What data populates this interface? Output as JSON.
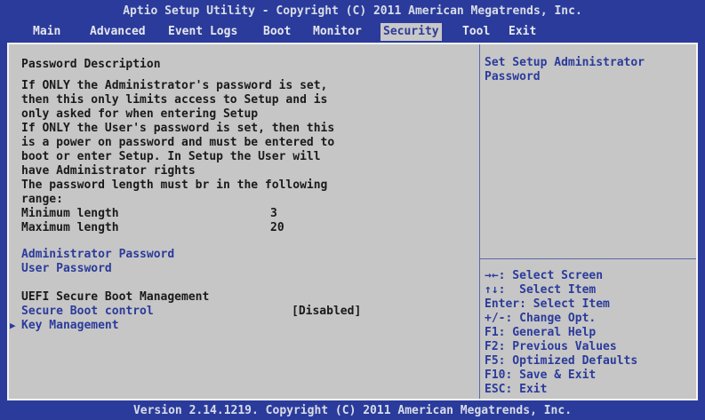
{
  "header": {
    "title": "Aptio Setup Utility - Copyright (C) 2011 American Megatrends, Inc."
  },
  "menu": {
    "tabs": [
      "Main",
      "Advanced",
      "Event Logs",
      "Boot",
      "Monitor",
      "Security",
      "Tool",
      "Exit"
    ],
    "active": "Security"
  },
  "main": {
    "section_title": "Password Description",
    "description_lines": [
      "If ONLY the Administrator's password is set,",
      "then this only limits access to Setup and is",
      "only asked for when entering Setup",
      "If ONLY the User's password is set, then this",
      "is a power on password and must be entered to",
      "boot or enter Setup. In Setup the User will",
      "have Administrator rights",
      "The password length must br in the following",
      "range:"
    ],
    "min_label": "Minimum length",
    "min_value": "3",
    "max_label": "Maximum length",
    "max_value": "20",
    "admin_password": "Administrator Password",
    "user_password": "User Password",
    "uefi_title": "UEFI Secure Boot Management",
    "secure_boot_label": "Secure Boot control",
    "secure_boot_value": "[Disabled]",
    "key_mgmt_arrow": "▶",
    "key_mgmt_label": "Key Management"
  },
  "help": {
    "lines": [
      "Set Setup Administrator",
      "Password"
    ]
  },
  "keys": {
    "lines": [
      "→←: Select Screen",
      "↑↓:  Select Item",
      "Enter: Select Item",
      "+/-: Change Opt.",
      "F1: General Help",
      "F2: Previous Values",
      "F5: Optimized Defaults",
      "F10: Save & Exit",
      "ESC: Exit"
    ]
  },
  "footer": {
    "text": "Version 2.14.1219. Copyright (C) 2011 American Megatrends, Inc."
  },
  "colors": {
    "background": "#2b3b9b",
    "panel": "#c6c6c6",
    "highlight": "#2b3b9b"
  }
}
